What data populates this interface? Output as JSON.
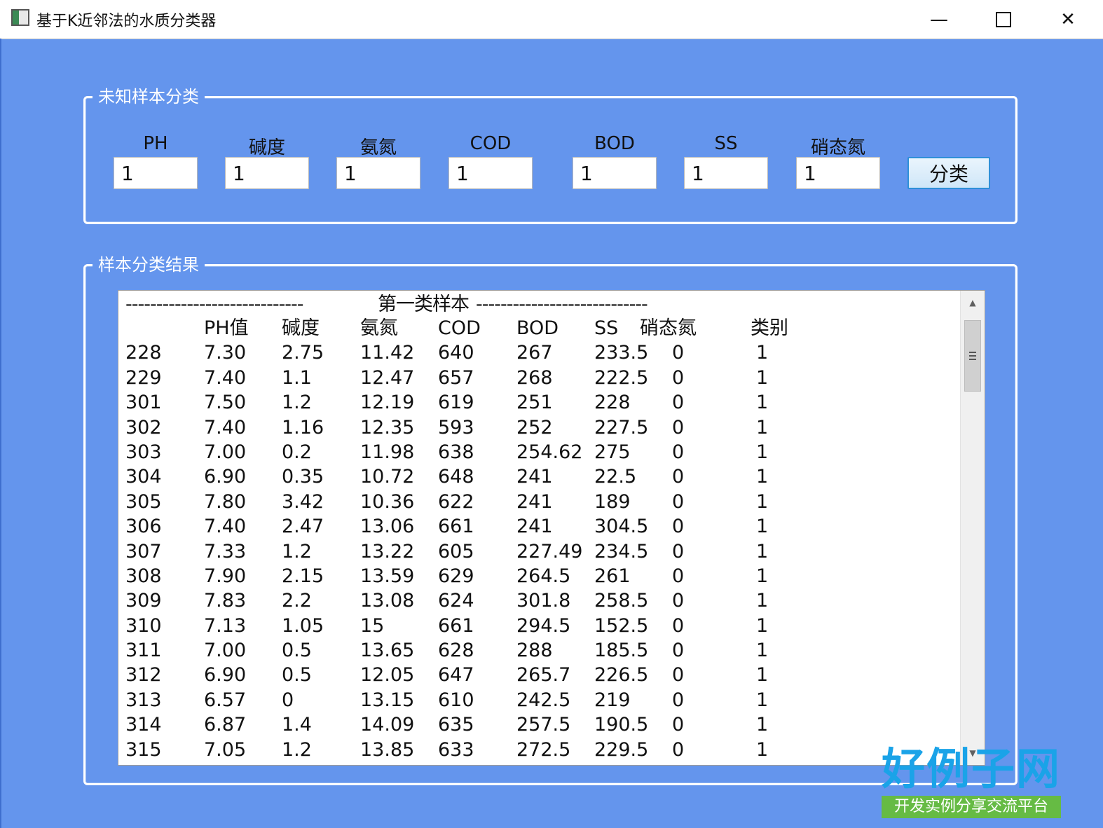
{
  "window": {
    "title": "基于K近邻法的水质分类器",
    "controls": {
      "minimize": "—",
      "maximize": "",
      "close": "✕"
    }
  },
  "input_group": {
    "legend": "未知样本分类",
    "fields": [
      {
        "label": "PH",
        "value": "1"
      },
      {
        "label": "碱度",
        "value": "1"
      },
      {
        "label": "氨氮",
        "value": "1"
      },
      {
        "label": "COD",
        "value": "1"
      },
      {
        "label": "BOD",
        "value": "1"
      },
      {
        "label": "SS",
        "value": "1"
      },
      {
        "label": "硝态氮",
        "value": "1"
      }
    ],
    "button": "分类"
  },
  "result_group": {
    "legend": "样本分类结果",
    "section_title": "第一类样本",
    "dashes_left": "-----------------------------",
    "dashes_right": "----------------------------",
    "headers": [
      "",
      "PH值",
      "碱度",
      "氨氮",
      "COD",
      "BOD",
      "SS",
      "硝态氮",
      "类别"
    ],
    "rows": [
      [
        "228",
        "7.30",
        "2.75",
        "11.42",
        "640",
        "267",
        "233.5",
        "0",
        "1"
      ],
      [
        "229",
        "7.40",
        "1.1",
        "12.47",
        "657",
        "268",
        "222.5",
        "0",
        "1"
      ],
      [
        "301",
        "7.50",
        "1.2",
        "12.19",
        "619",
        "251",
        "228",
        "0",
        "1"
      ],
      [
        "302",
        "7.40",
        "1.16",
        "12.35",
        "593",
        "252",
        "227.5",
        "0",
        "1"
      ],
      [
        "303",
        "7.00",
        "0.2",
        "11.98",
        "638",
        "254.62",
        "275",
        "0",
        "1"
      ],
      [
        "304",
        "6.90",
        "0.35",
        "10.72",
        "648",
        "241",
        "22.5",
        "0",
        "1"
      ],
      [
        "305",
        "7.80",
        "3.42",
        "10.36",
        "622",
        "241",
        "189",
        "0",
        "1"
      ],
      [
        "306",
        "7.40",
        "2.47",
        "13.06",
        "661",
        "241",
        "304.5",
        "0",
        "1"
      ],
      [
        "307",
        "7.33",
        "1.2",
        "13.22",
        "605",
        "227.49",
        "234.5",
        "0",
        "1"
      ],
      [
        "308",
        "7.90",
        "2.15",
        "13.59",
        "629",
        "264.5",
        "261",
        "0",
        "1"
      ],
      [
        "309",
        "7.83",
        "2.2",
        "13.08",
        "624",
        "301.8",
        "258.5",
        "0",
        "1"
      ],
      [
        "310",
        "7.13",
        "1.05",
        "15",
        "661",
        "294.5",
        "152.5",
        "0",
        "1"
      ],
      [
        "311",
        "7.00",
        "0.5",
        "13.65",
        "628",
        "288",
        "185.5",
        "0",
        "1"
      ],
      [
        "312",
        "6.90",
        "0.5",
        "12.05",
        "647",
        "265.7",
        "226.5",
        "0",
        "1"
      ],
      [
        "313",
        "6.57",
        "0",
        "13.15",
        "610",
        "242.5",
        "219",
        "0",
        "1"
      ],
      [
        "314",
        "6.87",
        "1.4",
        "14.09",
        "635",
        "257.5",
        "190.5",
        "0",
        "1"
      ],
      [
        "315",
        "7.05",
        "1.2",
        "13.85",
        "633",
        "272.5",
        "229.5",
        "0",
        "1"
      ]
    ]
  },
  "watermark": {
    "brand": "好例子网",
    "slogan": "开发实例分享交流平台"
  },
  "colors": {
    "background": "#6495ED",
    "button_border": "#2f8fd8",
    "logo_blue": "#1aa3e8",
    "logo_green": "#66bb44"
  }
}
